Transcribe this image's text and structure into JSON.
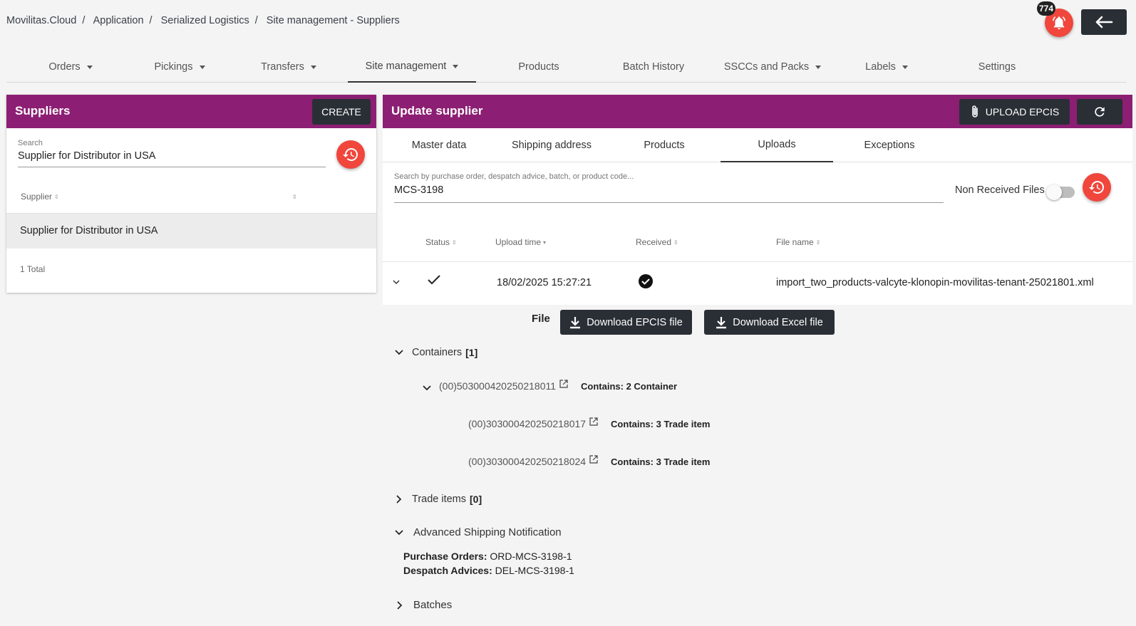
{
  "breadcrumb": {
    "items": [
      "Movilitas.Cloud",
      "Application",
      "Serialized Logistics",
      "Site management - Suppliers"
    ]
  },
  "header": {
    "notification_count": "774",
    "bell_icon": "bell-icon",
    "back_icon": "arrow-left-icon"
  },
  "nav": {
    "tabs": [
      {
        "label": "Orders",
        "dropdown": true
      },
      {
        "label": "Pickings",
        "dropdown": true
      },
      {
        "label": "Transfers",
        "dropdown": true
      },
      {
        "label": "Site management",
        "dropdown": true,
        "active": true
      },
      {
        "label": "Products",
        "dropdown": false
      },
      {
        "label": "Batch History",
        "dropdown": false
      },
      {
        "label": "SSCCs and Packs",
        "dropdown": true
      },
      {
        "label": "Labels",
        "dropdown": true
      },
      {
        "label": "Settings",
        "dropdown": false
      }
    ]
  },
  "left": {
    "title": "Suppliers",
    "create_label": "CREATE",
    "search_label": "Search",
    "search_value": "Supplier for Distributor in USA",
    "column_header": "Supplier",
    "rows": [
      "Supplier for Distributor in USA"
    ],
    "total": "1 Total"
  },
  "right": {
    "title": "Update supplier",
    "upload_label": "UPLOAD EPCIS",
    "tabs": [
      "Master data",
      "Shipping address",
      "Products",
      "Uploads",
      "Exceptions"
    ],
    "active_tab": "Uploads",
    "search_label": "Search by purchase order, despatch advice, batch, or product code...",
    "search_value": "MCS-3198",
    "toggle_label": "Non Received Files",
    "toggle_on": false,
    "columns": {
      "status": "Status",
      "upload_time": "Upload time",
      "received": "Received",
      "file_name": "File name"
    },
    "row": {
      "upload_time": "18/02/2025 15:27:21",
      "file_name": "import_two_products-valcyte-klonopin-movilitas-tenant-25021801.xml"
    }
  },
  "detail": {
    "file_label": "File",
    "download_epcis": "Download EPCIS file",
    "download_excel": "Download Excel file",
    "containers_label": "Containers",
    "containers_count": "[1]",
    "container_id": "(00)503000420250218011",
    "container_contains": "Contains: 2 Container",
    "children": [
      {
        "id": "(00)303000420250218017",
        "contains": "Contains: 3 Trade item"
      },
      {
        "id": "(00)303000420250218024",
        "contains": "Contains: 3 Trade item"
      }
    ],
    "trade_items_label": "Trade items",
    "trade_items_count": "[0]",
    "asn_label": "Advanced Shipping Notification",
    "po_label": "Purchase Orders:",
    "po_value": "ORD-MCS-3198-1",
    "da_label": "Despatch Advices:",
    "da_value": "DEL-MCS-3198-1",
    "batches_label": "Batches"
  },
  "colors": {
    "accent": "#8c1f73",
    "fab": "#f0463c",
    "dark_button": "#2a2f36"
  }
}
